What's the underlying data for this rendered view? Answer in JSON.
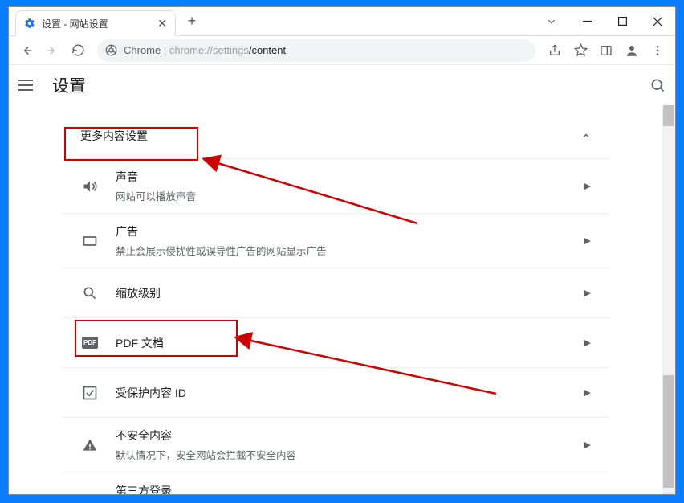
{
  "window": {
    "tab_title": "设置 - 网站设置",
    "url_prefix": "Chrome",
    "url_sep": " | ",
    "url_host": "chrome://settings",
    "url_path": "/content"
  },
  "page": {
    "title": "设置"
  },
  "section": {
    "header": "更多内容设置"
  },
  "rows": {
    "sound": {
      "title": "声音",
      "desc": "网站可以播放声音"
    },
    "ads": {
      "title": "广告",
      "desc": "禁止会展示侵扰性或误导性广告的网站显示广告"
    },
    "zoom": {
      "title": "缩放级别"
    },
    "pdf": {
      "title": "PDF 文档",
      "badge": "PDF"
    },
    "protected": {
      "title": "受保护内容 ID"
    },
    "insecure": {
      "title": "不安全内容",
      "desc": "默认情况下，安全网站会拦截不安全内容"
    },
    "thirdparty": {
      "title": "第三方登录"
    }
  }
}
